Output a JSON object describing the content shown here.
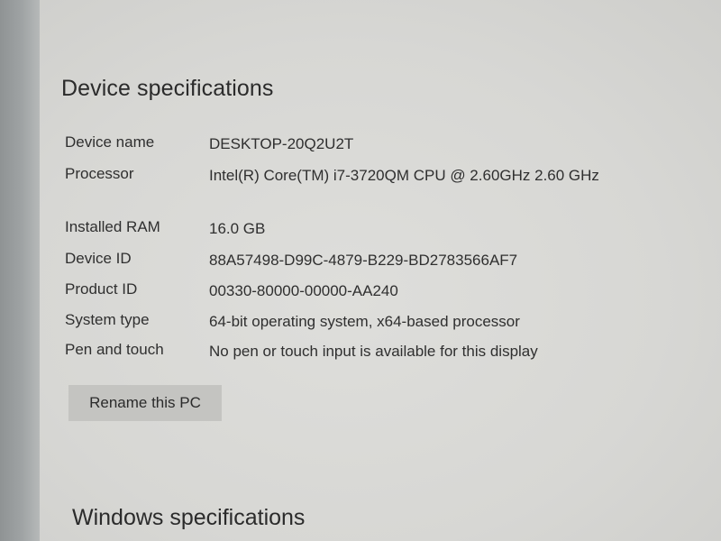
{
  "device_specifications": {
    "title": "Device specifications",
    "rows": [
      {
        "label": "Device name",
        "value": "DESKTOP-20Q2U2T"
      },
      {
        "label": "Processor",
        "value": "Intel(R) Core(TM) i7-3720QM CPU @ 2.60GHz   2.60 GHz"
      },
      {
        "label": "Installed RAM",
        "value": "16.0 GB"
      },
      {
        "label": "Device ID",
        "value": "88A57498-D99C-4879-B229-BD2783566AF7"
      },
      {
        "label": "Product ID",
        "value": "00330-80000-00000-AA240"
      },
      {
        "label": "System type",
        "value": "64-bit operating system, x64-based processor"
      },
      {
        "label": "Pen and touch",
        "value": "No pen or touch input is available for this display"
      }
    ],
    "rename_button": "Rename this PC"
  },
  "windows_specifications": {
    "title": "Windows specifications"
  }
}
